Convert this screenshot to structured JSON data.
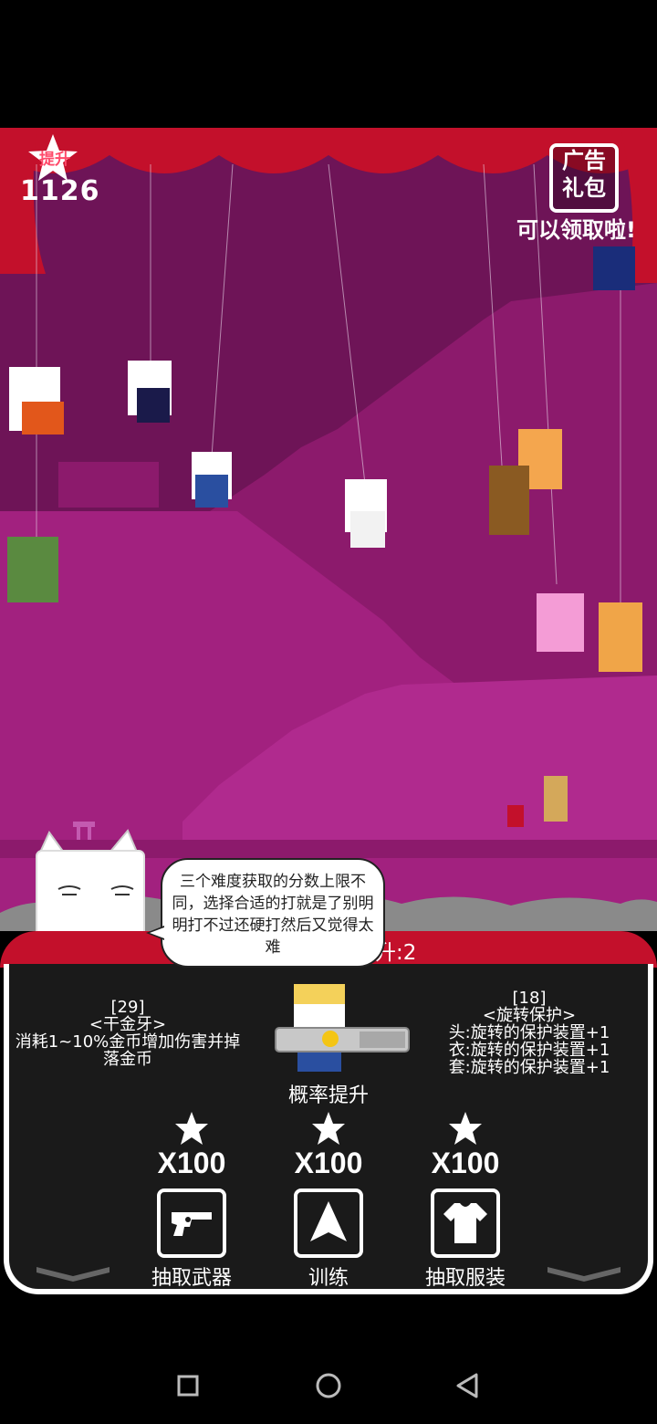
{
  "hud": {
    "score_label": "提升",
    "score_value": "1126",
    "gift_line1": "广告",
    "gift_line2": "礼包",
    "gift_note": "可以领取啦!"
  },
  "dialog": {
    "text": "三个难度获取的分数上限不同，选择合适的打就是了别明明打不过还硬打然后又觉得太难"
  },
  "panel": {
    "title": "当前关卡倍数提升:2",
    "left_skill": {
      "level": "[29]",
      "name": "<干金牙>",
      "desc": "消耗1~10%金币增加伤害并掉落金币"
    },
    "right_skill": {
      "level": "[18]",
      "name": "<旋转保护>",
      "lines": [
        "头:旋转的保护装置+1",
        "衣:旋转的保护装置+1",
        "套:旋转的保护装置+1"
      ]
    },
    "center_label": "概率提升",
    "costs": [
      "X100",
      "X100",
      "X100"
    ],
    "actions": {
      "weapon": "抽取武器",
      "train": "训练",
      "clothes": "抽取服装"
    }
  },
  "colors": {
    "stage": "#a2217f",
    "stage_dark": "#6e1457",
    "curtain": "#c3102b",
    "panel": "#1a1a1a"
  },
  "icons": [
    "star-icon",
    "revolver-icon",
    "arrow-up-icon",
    "tshirt-icon",
    "chevron-down-icon",
    "square-icon",
    "circle-icon",
    "triangle-back-icon"
  ]
}
